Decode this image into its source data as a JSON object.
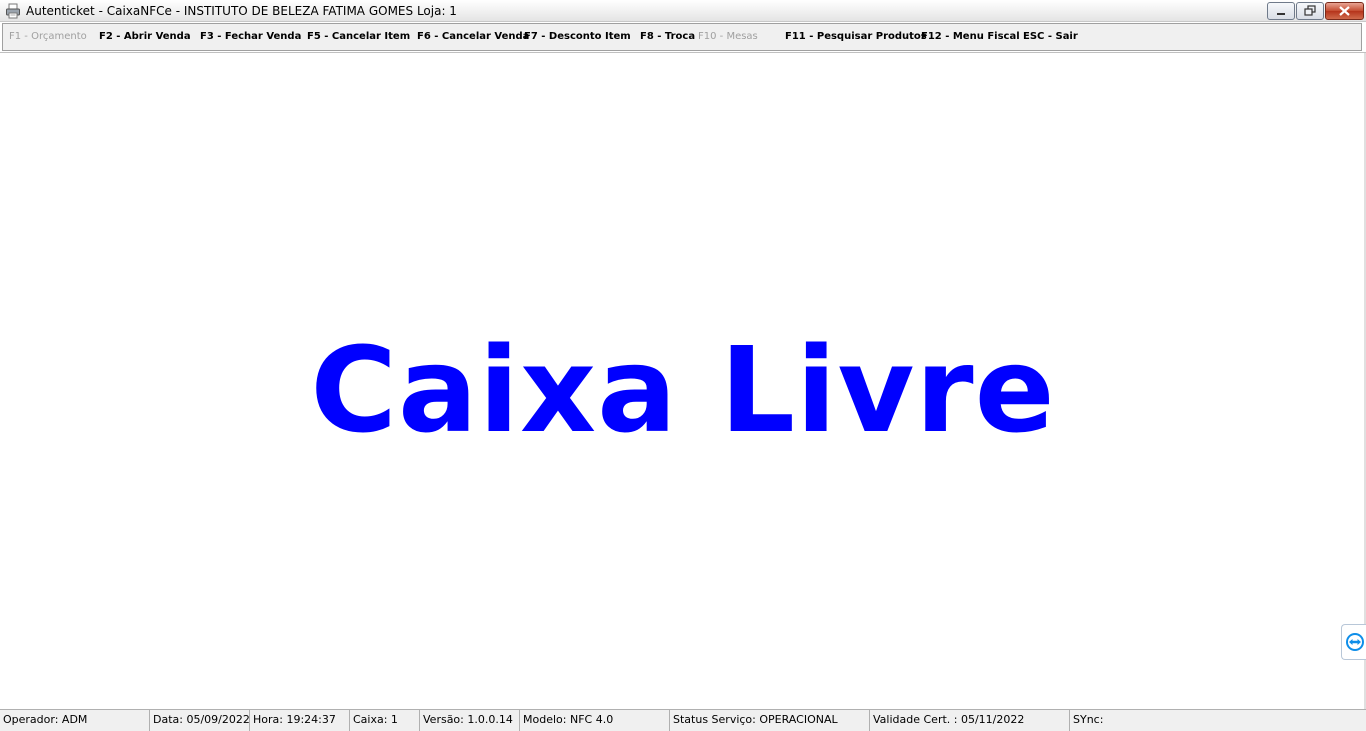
{
  "window": {
    "title": "Autenticket - CaixaNFCe - INSTITUTO DE BELEZA FATIMA GOMES Loja: 1"
  },
  "toolbar": {
    "buttons": [
      {
        "label": "F1 - Orçamento",
        "enabled": false
      },
      {
        "label": "F2 - Abrir Venda",
        "enabled": true
      },
      {
        "label": "F3 - Fechar Venda",
        "enabled": true
      },
      {
        "label": "F5 - Cancelar Item",
        "enabled": true
      },
      {
        "label": "F6 - Cancelar Venda",
        "enabled": true
      },
      {
        "label": "F7 - Desconto Item",
        "enabled": true
      },
      {
        "label": "F8 - Troca",
        "enabled": true
      },
      {
        "label": "F10 - Mesas",
        "enabled": false
      },
      {
        "label": "F11 - Pesquisar Produtos",
        "enabled": true
      },
      {
        "label": "F12 - Menu Fiscal",
        "enabled": true
      },
      {
        "label": "ESC - Sair",
        "enabled": true
      }
    ]
  },
  "main": {
    "message": "Caixa Livre",
    "message_color": "#0000ff"
  },
  "statusbar": {
    "operador": "Operador: ADM",
    "data": "Data: 05/09/2022",
    "hora": "Hora: 19:24:37",
    "caixa": "Caixa: 1",
    "versao": "Versão: 1.0.0.14",
    "modelo": "Modelo: NFC 4.0",
    "status_servico": "Status Serviço: OPERACIONAL",
    "validade_cert": "Validade Cert. : 05/11/2022",
    "sync": "SYnc:"
  },
  "icons": {
    "app": "printer-icon",
    "minimize": "minimize-icon",
    "maximize": "restore-icon",
    "close": "close-icon",
    "side_tab": "remote-support-icon"
  }
}
